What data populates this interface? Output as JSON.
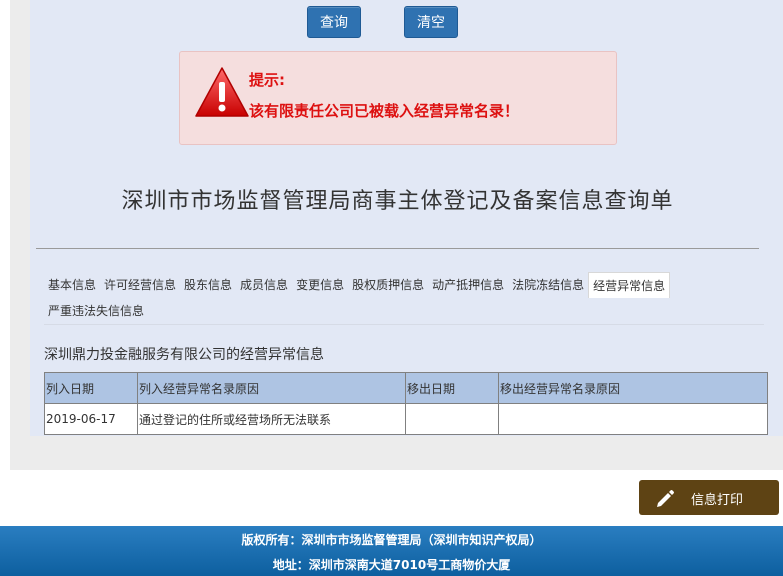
{
  "toolbar": {
    "query_label": "查询",
    "clear_label": "清空"
  },
  "alert": {
    "title": "提示:",
    "message": "该有限责任公司已被载入经营异常名录！"
  },
  "doc_title": "深圳市市场监督管理局商事主体登记及备案信息查询单",
  "tabs": {
    "row1": [
      "基本信息",
      "许可经营信息",
      "股东信息",
      "成员信息",
      "变更信息",
      "股权质押信息",
      "动产抵押信息",
      "法院冻结信息",
      "经营异常信息"
    ],
    "row2": [
      "严重违法失信信息"
    ],
    "active": "经营异常信息"
  },
  "section_title": "深圳鼎力投金融服务有限公司的经营异常信息",
  "table": {
    "headers": [
      "列入日期",
      "列入经营异常名录原因",
      "移出日期",
      "移出经营异常名录原因"
    ],
    "rows": [
      [
        "2019-06-17",
        "通过登记的住所或经营场所无法联系",
        "",
        ""
      ]
    ]
  },
  "print_label": "信息打印",
  "footer": {
    "line1": "版权所有：深圳市市场监督管理局（深圳市知识产权局）",
    "line2": "地址：深圳市深南大道7010号工商物价大厦"
  },
  "colors": {
    "footer": "#1a6fb0",
    "button": "#2f72b1",
    "alert_text": "#dd1111",
    "print_button": "#5e4314"
  }
}
